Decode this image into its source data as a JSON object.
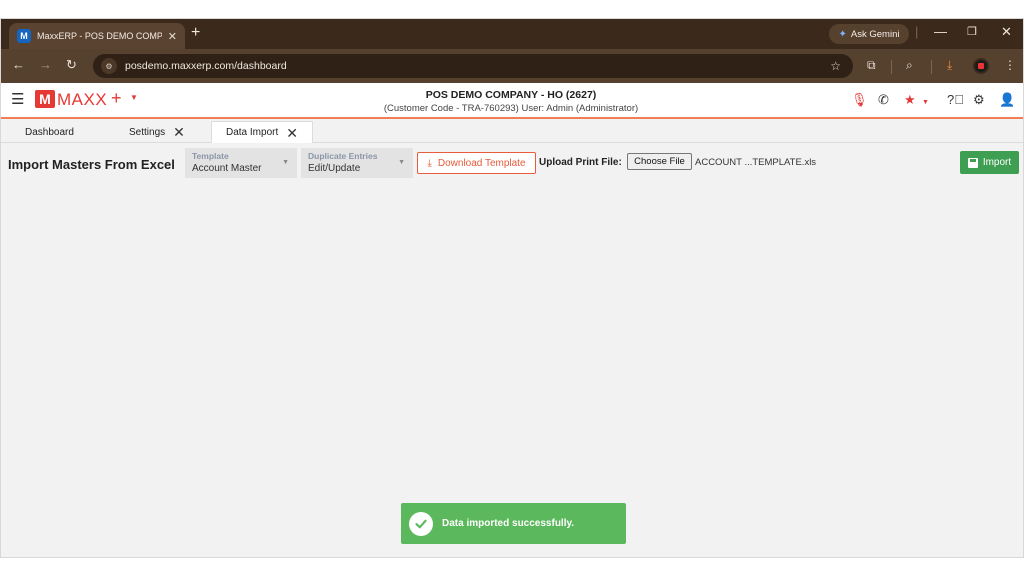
{
  "browser": {
    "tab_title": "MaxxERP - POS DEMO COMPANY",
    "tab_favicon": "M",
    "new_tab": "+",
    "ask_gemini": "Ask Gemini",
    "url": "posdemo.maxxerp.com/dashboard"
  },
  "header": {
    "logo_letter": "M",
    "logo_text": "MAXX",
    "company": "POS DEMO COMPANY - HO (2627)",
    "customer_info": "(Customer Code - TRA-760293) User: Admin (Administrator)"
  },
  "tabs": [
    {
      "label": "Dashboard"
    },
    {
      "label": "Settings"
    },
    {
      "label": "Data Import"
    }
  ],
  "form": {
    "title": "Import Masters From Excel",
    "template_label": "Template",
    "template_value": "Account Master",
    "duplicate_label": "Duplicate Entries",
    "duplicate_value": "Edit/Update",
    "download_label": "Download Template",
    "upload_label": "Upload Print File:",
    "choose_file": "Choose File",
    "file_name": "ACCOUNT ...TEMPLATE.xls",
    "import_label": "Import"
  },
  "toast": {
    "message": "Data imported successfully."
  },
  "colors": {
    "accent": "#e53935",
    "success": "#5cb85c",
    "import_button": "#3e9e52",
    "download_border": "#e85b3b"
  }
}
